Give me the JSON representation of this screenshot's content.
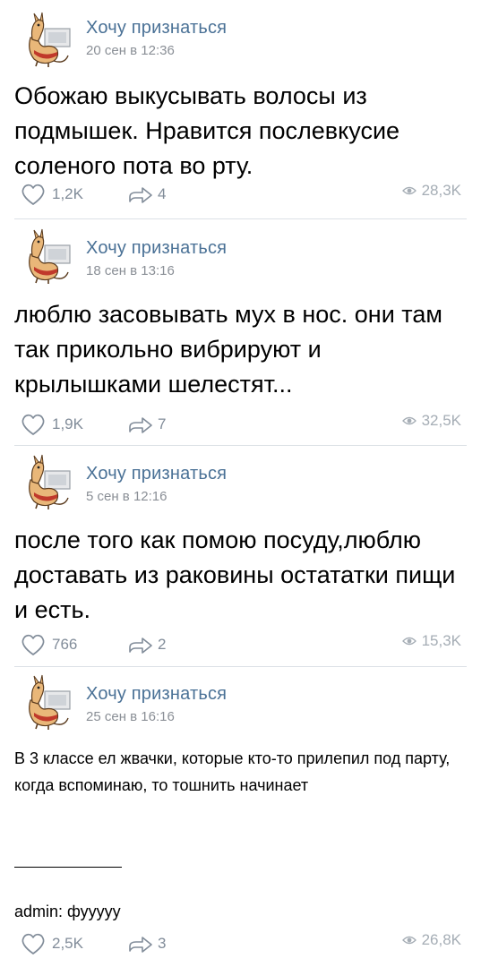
{
  "colors": {
    "author": "#4a7196",
    "meta": "#8a8f96",
    "divider": "#dce1e6"
  },
  "posts": [
    {
      "author": "Хочу признаться",
      "date": "20 сен в 12:36",
      "text": "Обожаю выкусывать волосы из подмышек. Нравится послевкусие соленого пота во рту.",
      "likes": "1,2K",
      "shares": "4",
      "views": "28,3K",
      "icons": {
        "like": "heart-icon",
        "share": "share-arrow-icon",
        "views": "eye-icon"
      }
    },
    {
      "author": "Хочу признаться",
      "date": "18 сен в 13:16",
      "text": "люблю засовывать мух в нос. они там так прикольно вибрируют и крылышками шелестят...",
      "likes": "1,9K",
      "shares": "7",
      "views": "32,5K",
      "icons": {
        "like": "heart-icon",
        "share": "share-arrow-icon",
        "views": "eye-icon"
      }
    },
    {
      "author": "Хочу признаться",
      "date": "5 сен в 12:16",
      "text": "после того как помою посуду,люблю доставать из раковины остататки пищи и есть.",
      "likes": "766",
      "shares": "2",
      "views": "15,3K",
      "icons": {
        "like": "heart-icon",
        "share": "share-arrow-icon",
        "views": "eye-icon"
      }
    },
    {
      "author": "Хочу признаться",
      "date": "25 сен в 16:16",
      "text": "В 3 классе ел жвачки, которые кто-то прилепил под парту, когда вспоминаю, то тошнить начинает",
      "admin_note": "admin: фууууу",
      "likes": "2,5K",
      "shares": "3",
      "views": "26,8K",
      "icons": {
        "like": "heart-icon",
        "share": "share-arrow-icon",
        "views": "eye-icon"
      }
    }
  ]
}
